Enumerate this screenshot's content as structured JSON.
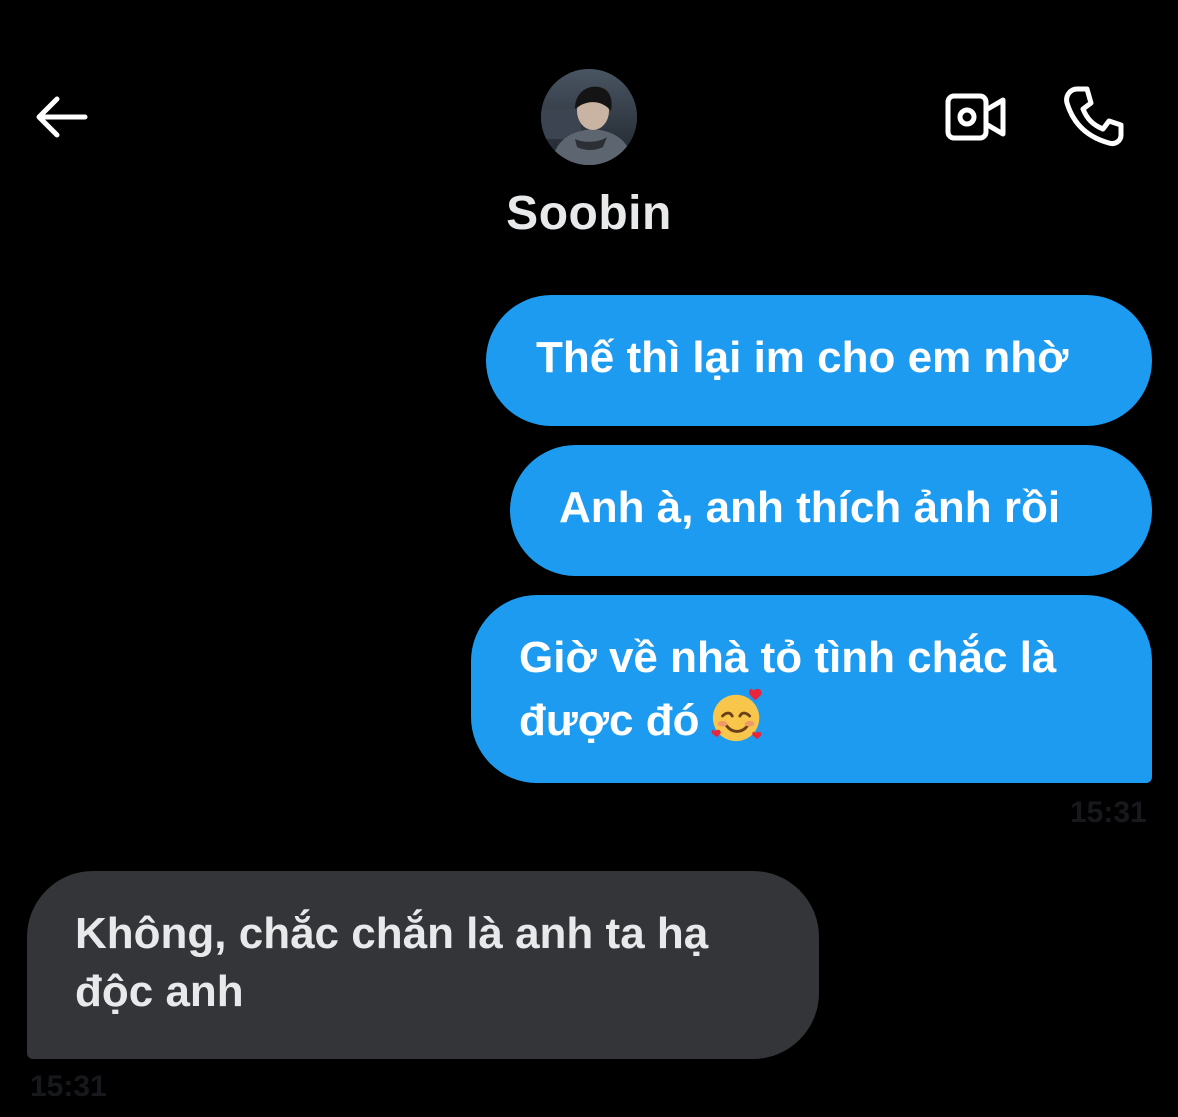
{
  "header": {
    "back_icon": "arrow-left-icon",
    "contact_name": "Soobin",
    "video_icon": "video-camera-icon",
    "call_icon": "phone-icon"
  },
  "messages": [
    {
      "direction": "sent",
      "text": "Thế thì lại im cho em nhờ"
    },
    {
      "direction": "sent",
      "text": "Anh à, anh thích ảnh rồi"
    },
    {
      "direction": "sent",
      "text": "Giờ về nhà tỏ tình chắc là được đó",
      "emoji": "smiling-face-with-hearts-icon"
    },
    {
      "direction": "received",
      "text": "Không, chắc chắn là anh ta hạ độc anh"
    }
  ],
  "timestamps": {
    "sent": "15:31",
    "received": "15:31"
  },
  "colors": {
    "background": "#000000",
    "sent_bubble": "#1d9bf0",
    "received_bubble": "#333539",
    "name_text": "#e7e9ea"
  }
}
